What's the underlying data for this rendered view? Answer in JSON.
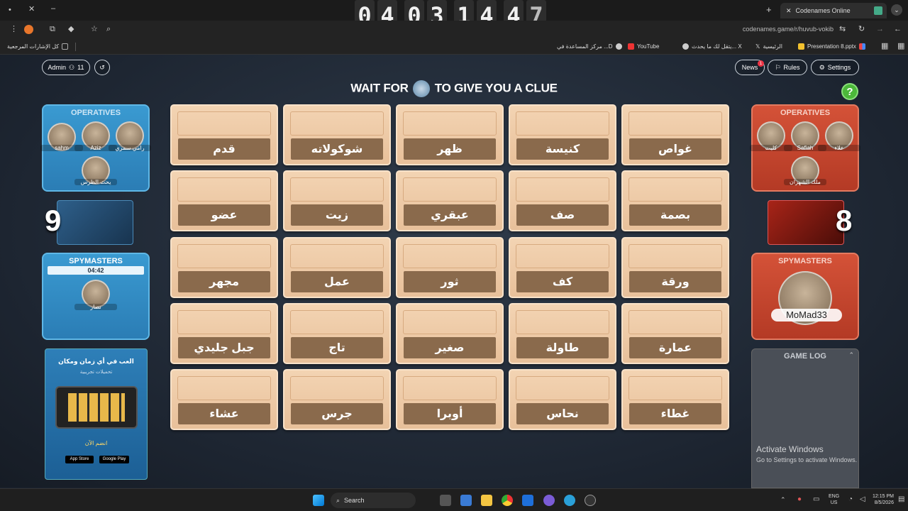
{
  "browser": {
    "tab_title": "Codenames Online",
    "url": "codenames.game/r/huvub-vokib",
    "bookmarks": [
      "كل الإشارات المرجعية",
      "Presentation 8.pptx",
      "الرئيسية",
      "يتقل لك ما يحدث... X",
      "YouTube",
      "مركز المساعدة في ...D"
    ]
  },
  "clock": {
    "d": [
      "0",
      "4",
      "0",
      "3",
      "1",
      "4",
      "4",
      "7"
    ]
  },
  "header": {
    "admin_label": "Admin",
    "player_count": "11",
    "news_label": "News",
    "news_badge": "1",
    "rules_label": "Rules",
    "settings_label": "Settings",
    "clue_prefix": "WAIT FOR",
    "clue_suffix": "TO GIVE YOU A CLUE",
    "help": "?"
  },
  "blue": {
    "operatives_title": "OPERATIVES",
    "operatives": [
      "sahm",
      "Aziz",
      "رامي سمري",
      "يحث الظرس"
    ],
    "score": "9",
    "spymasters_title": "SPYMASTERS",
    "timer": "04:42",
    "spymaster": "نصار"
  },
  "red": {
    "operatives_title": "OPERATIVES",
    "operatives": [
      "كليت",
      "Safiah",
      "علاء",
      "ملك الشهران"
    ],
    "score": "8",
    "spymasters_title": "SPYMASTERS",
    "spymaster": "MoMad33"
  },
  "promo": {
    "headline": "العب في أي زمان ومكان",
    "sub": "تحميلات تجريبية",
    "cta": "انضم الآن",
    "appstore": "App Store",
    "googleplay": "Google Play"
  },
  "board": [
    [
      "قدم",
      "شوكولاته",
      "ظهر",
      "كنيسة",
      "غواص"
    ],
    [
      "عضو",
      "زيت",
      "عبقري",
      "صف",
      "بصمة"
    ],
    [
      "مجهر",
      "عمل",
      "ثور",
      "كف",
      "ورقة"
    ],
    [
      "جبل جليدي",
      "تاج",
      "صغير",
      "طاولة",
      "عمارة"
    ],
    [
      "عشاء",
      "جرس",
      "أوبرا",
      "نحاس",
      "غطاء"
    ]
  ],
  "game_log": {
    "title": "GAME LOG"
  },
  "watermark": {
    "line1": "Activate Windows",
    "line2": "Go to Settings to activate Windows."
  },
  "taskbar": {
    "search": "Search",
    "lang1": "ENG",
    "lang2": "US",
    "time": "12:15 PM",
    "date": "8/5/2026"
  }
}
